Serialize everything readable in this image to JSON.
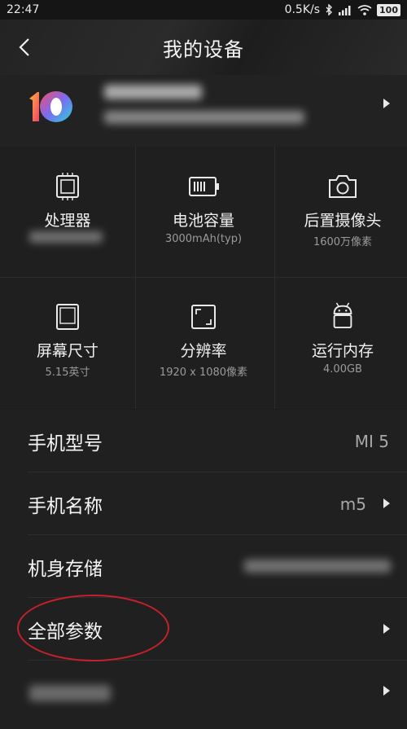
{
  "status_bar": {
    "time": "22:47",
    "speed": "0.5K/s",
    "battery": "100"
  },
  "header": {
    "title": "我的设备"
  },
  "specs": [
    {
      "label": "处理器",
      "icon": "cpu-icon"
    },
    {
      "label": "电池容量",
      "value": "3000mAh(typ)",
      "icon": "battery-icon"
    },
    {
      "label": "后置摄像头",
      "value": "1600万像素",
      "icon": "camera-icon"
    },
    {
      "label": "屏幕尺寸",
      "value": "5.15英寸",
      "icon": "screen-icon"
    },
    {
      "label": "分辨率",
      "value": "1920 x 1080像素",
      "icon": "resolution-icon"
    },
    {
      "label": "运行内存",
      "value": "4.00GB",
      "icon": "android-icon"
    }
  ],
  "rows": {
    "model": {
      "label": "手机型号",
      "value": "MI 5"
    },
    "name": {
      "label": "手机名称",
      "value": "m5"
    },
    "storage": {
      "label": "机身存储"
    },
    "all_params": {
      "label": "全部参数"
    }
  },
  "colors": {
    "highlight_circle": "#c8202a",
    "background": "#1c1c1c"
  }
}
